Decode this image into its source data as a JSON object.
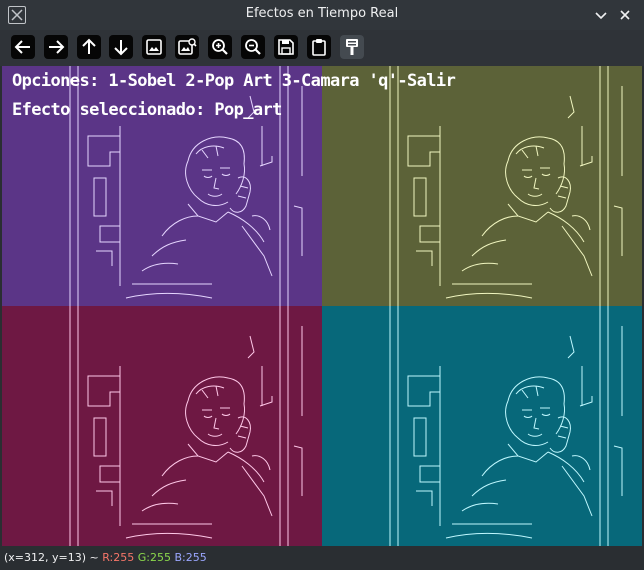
{
  "window": {
    "title": "Efectos en Tiempo Real"
  },
  "toolbar": {
    "buttons": [
      {
        "name": "pan-left-button",
        "icon": "arrow-left-icon"
      },
      {
        "name": "pan-right-button",
        "icon": "arrow-right-icon"
      },
      {
        "name": "pan-up-button",
        "icon": "arrow-up-icon"
      },
      {
        "name": "pan-down-button",
        "icon": "arrow-down-icon"
      },
      {
        "name": "zoom-original-button",
        "icon": "image-icon"
      },
      {
        "name": "zoom-fit-button",
        "icon": "image-zoom-icon"
      },
      {
        "name": "zoom-in-button",
        "icon": "zoom-in-icon"
      },
      {
        "name": "zoom-out-button",
        "icon": "zoom-out-icon"
      },
      {
        "name": "save-button",
        "icon": "floppy-disk-icon"
      },
      {
        "name": "copy-button",
        "icon": "clipboard-icon"
      },
      {
        "name": "properties-button",
        "icon": "paint-brush-icon"
      }
    ]
  },
  "image": {
    "overlay_line1": "Opciones: 1-Sobel 2-Pop Art 3-Camara 'q'-Salir",
    "overlay_line2": "Efecto seleccionado: Pop_art",
    "quadrant_colors": {
      "top_left": "#5b3587",
      "top_right": "#5c6238",
      "bottom_left": "#6e1843",
      "bottom_right": "#07687a"
    },
    "edge_colors": {
      "top_left": "#e6d6ff",
      "top_right": "#f1f6c0",
      "bottom_left": "#ffc8e8",
      "bottom_right": "#bff8ff"
    }
  },
  "status": {
    "coords": "(x=312, y=13) ~ ",
    "r": "R:255",
    "g": "G:255",
    "b": "B:255",
    "r_color": "#f77669",
    "g_color": "#8bd84c",
    "b_color": "#9ba7ff"
  }
}
